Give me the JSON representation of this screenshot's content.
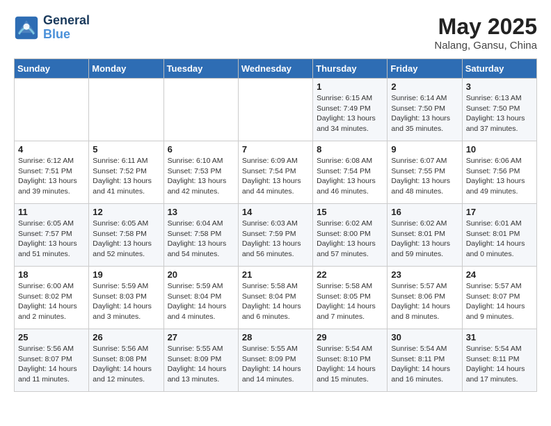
{
  "header": {
    "logo_line1": "General",
    "logo_line2": "Blue",
    "month_year": "May 2025",
    "location": "Nalang, Gansu, China"
  },
  "weekdays": [
    "Sunday",
    "Monday",
    "Tuesday",
    "Wednesday",
    "Thursday",
    "Friday",
    "Saturday"
  ],
  "weeks": [
    [
      {
        "day": "",
        "info": ""
      },
      {
        "day": "",
        "info": ""
      },
      {
        "day": "",
        "info": ""
      },
      {
        "day": "",
        "info": ""
      },
      {
        "day": "1",
        "info": "Sunrise: 6:15 AM\nSunset: 7:49 PM\nDaylight: 13 hours\nand 34 minutes."
      },
      {
        "day": "2",
        "info": "Sunrise: 6:14 AM\nSunset: 7:50 PM\nDaylight: 13 hours\nand 35 minutes."
      },
      {
        "day": "3",
        "info": "Sunrise: 6:13 AM\nSunset: 7:50 PM\nDaylight: 13 hours\nand 37 minutes."
      }
    ],
    [
      {
        "day": "4",
        "info": "Sunrise: 6:12 AM\nSunset: 7:51 PM\nDaylight: 13 hours\nand 39 minutes."
      },
      {
        "day": "5",
        "info": "Sunrise: 6:11 AM\nSunset: 7:52 PM\nDaylight: 13 hours\nand 41 minutes."
      },
      {
        "day": "6",
        "info": "Sunrise: 6:10 AM\nSunset: 7:53 PM\nDaylight: 13 hours\nand 42 minutes."
      },
      {
        "day": "7",
        "info": "Sunrise: 6:09 AM\nSunset: 7:54 PM\nDaylight: 13 hours\nand 44 minutes."
      },
      {
        "day": "8",
        "info": "Sunrise: 6:08 AM\nSunset: 7:54 PM\nDaylight: 13 hours\nand 46 minutes."
      },
      {
        "day": "9",
        "info": "Sunrise: 6:07 AM\nSunset: 7:55 PM\nDaylight: 13 hours\nand 48 minutes."
      },
      {
        "day": "10",
        "info": "Sunrise: 6:06 AM\nSunset: 7:56 PM\nDaylight: 13 hours\nand 49 minutes."
      }
    ],
    [
      {
        "day": "11",
        "info": "Sunrise: 6:05 AM\nSunset: 7:57 PM\nDaylight: 13 hours\nand 51 minutes."
      },
      {
        "day": "12",
        "info": "Sunrise: 6:05 AM\nSunset: 7:58 PM\nDaylight: 13 hours\nand 52 minutes."
      },
      {
        "day": "13",
        "info": "Sunrise: 6:04 AM\nSunset: 7:58 PM\nDaylight: 13 hours\nand 54 minutes."
      },
      {
        "day": "14",
        "info": "Sunrise: 6:03 AM\nSunset: 7:59 PM\nDaylight: 13 hours\nand 56 minutes."
      },
      {
        "day": "15",
        "info": "Sunrise: 6:02 AM\nSunset: 8:00 PM\nDaylight: 13 hours\nand 57 minutes."
      },
      {
        "day": "16",
        "info": "Sunrise: 6:02 AM\nSunset: 8:01 PM\nDaylight: 13 hours\nand 59 minutes."
      },
      {
        "day": "17",
        "info": "Sunrise: 6:01 AM\nSunset: 8:01 PM\nDaylight: 14 hours\nand 0 minutes."
      }
    ],
    [
      {
        "day": "18",
        "info": "Sunrise: 6:00 AM\nSunset: 8:02 PM\nDaylight: 14 hours\nand 2 minutes."
      },
      {
        "day": "19",
        "info": "Sunrise: 5:59 AM\nSunset: 8:03 PM\nDaylight: 14 hours\nand 3 minutes."
      },
      {
        "day": "20",
        "info": "Sunrise: 5:59 AM\nSunset: 8:04 PM\nDaylight: 14 hours\nand 4 minutes."
      },
      {
        "day": "21",
        "info": "Sunrise: 5:58 AM\nSunset: 8:04 PM\nDaylight: 14 hours\nand 6 minutes."
      },
      {
        "day": "22",
        "info": "Sunrise: 5:58 AM\nSunset: 8:05 PM\nDaylight: 14 hours\nand 7 minutes."
      },
      {
        "day": "23",
        "info": "Sunrise: 5:57 AM\nSunset: 8:06 PM\nDaylight: 14 hours\nand 8 minutes."
      },
      {
        "day": "24",
        "info": "Sunrise: 5:57 AM\nSunset: 8:07 PM\nDaylight: 14 hours\nand 9 minutes."
      }
    ],
    [
      {
        "day": "25",
        "info": "Sunrise: 5:56 AM\nSunset: 8:07 PM\nDaylight: 14 hours\nand 11 minutes."
      },
      {
        "day": "26",
        "info": "Sunrise: 5:56 AM\nSunset: 8:08 PM\nDaylight: 14 hours\nand 12 minutes."
      },
      {
        "day": "27",
        "info": "Sunrise: 5:55 AM\nSunset: 8:09 PM\nDaylight: 14 hours\nand 13 minutes."
      },
      {
        "day": "28",
        "info": "Sunrise: 5:55 AM\nSunset: 8:09 PM\nDaylight: 14 hours\nand 14 minutes."
      },
      {
        "day": "29",
        "info": "Sunrise: 5:54 AM\nSunset: 8:10 PM\nDaylight: 14 hours\nand 15 minutes."
      },
      {
        "day": "30",
        "info": "Sunrise: 5:54 AM\nSunset: 8:11 PM\nDaylight: 14 hours\nand 16 minutes."
      },
      {
        "day": "31",
        "info": "Sunrise: 5:54 AM\nSunset: 8:11 PM\nDaylight: 14 hours\nand 17 minutes."
      }
    ]
  ]
}
